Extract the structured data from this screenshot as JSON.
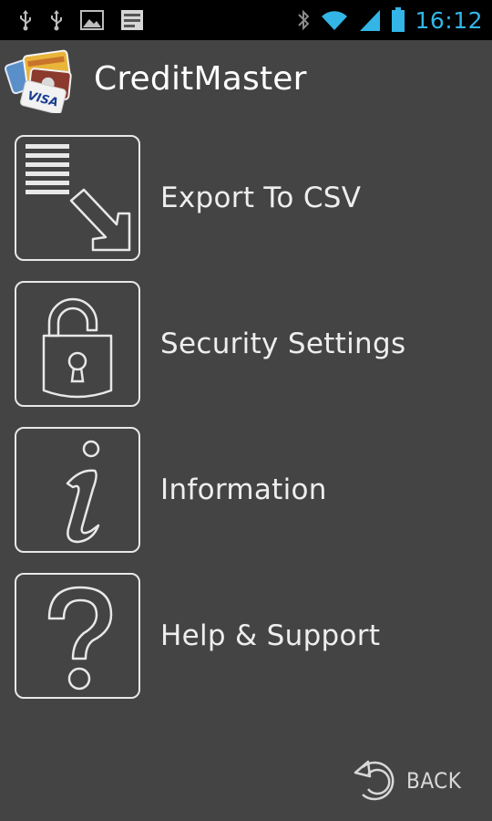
{
  "status_bar": {
    "icons": [
      "usb-icon",
      "usb-icon",
      "image-icon",
      "app-notification-icon",
      "bluetooth-icon",
      "wifi-icon",
      "signal-icon",
      "battery-icon"
    ],
    "time": "16:12",
    "time_color": "#33b5e5"
  },
  "header": {
    "title": "CreditMaster",
    "logo_icon": "credit-cards-logo-icon"
  },
  "menu": {
    "items": [
      {
        "label": "Export To CSV",
        "icon": "export-list-arrow-icon"
      },
      {
        "label": "Security Settings",
        "icon": "unlocked-padlock-icon"
      },
      {
        "label": "Information",
        "icon": "info-icon"
      },
      {
        "label": "Help & Support",
        "icon": "question-mark-icon"
      }
    ]
  },
  "footer": {
    "back_label": "BACK",
    "back_icon": "undo-arrow-icon"
  },
  "colors": {
    "background": "#444444",
    "status_bar": "#000000",
    "accent": "#33b5e5",
    "outline": "#e8e8e8"
  }
}
